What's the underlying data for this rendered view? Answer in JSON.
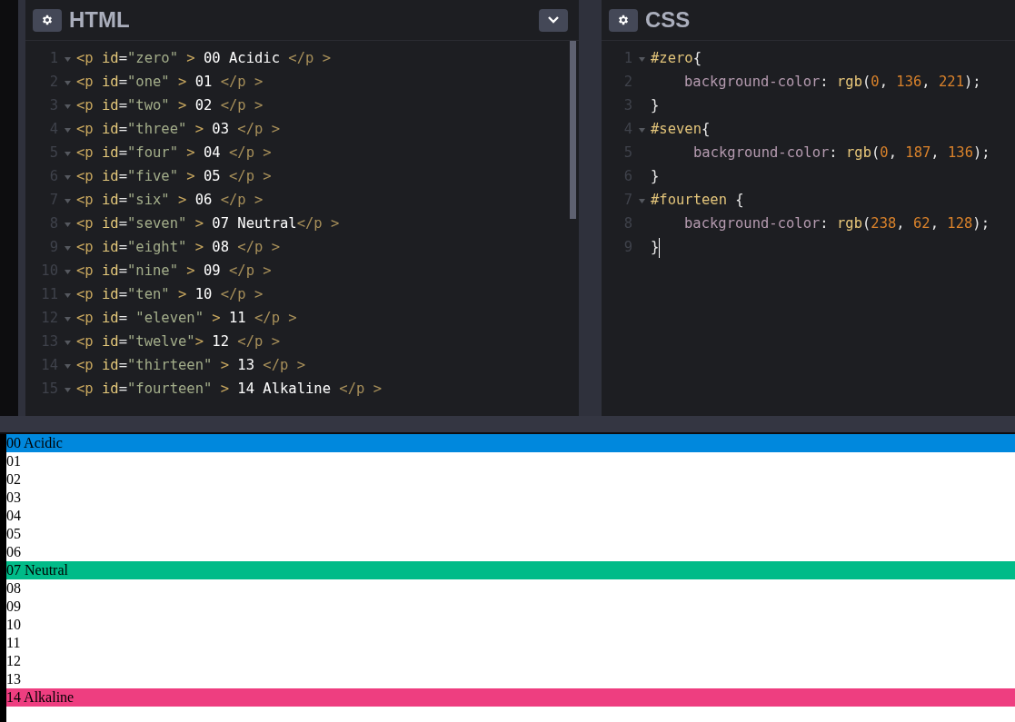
{
  "html_panel": {
    "title": "HTML",
    "lines": [
      {
        "number": "1",
        "foldable": true,
        "tokens": [
          {
            "kind": "tag",
            "text": "<p "
          },
          {
            "kind": "attr",
            "text": "id"
          },
          {
            "kind": "punct",
            "text": "="
          },
          {
            "kind": "string",
            "text": "\"zero\""
          },
          {
            "kind": "tag",
            "text": " > "
          },
          {
            "kind": "text",
            "text": "00 Acidic "
          },
          {
            "kind": "close",
            "text": "</p >"
          }
        ]
      },
      {
        "number": "2",
        "foldable": true,
        "tokens": [
          {
            "kind": "tag",
            "text": "<p "
          },
          {
            "kind": "attr",
            "text": "id"
          },
          {
            "kind": "punct",
            "text": "="
          },
          {
            "kind": "string",
            "text": "\"one\""
          },
          {
            "kind": "tag",
            "text": " > "
          },
          {
            "kind": "text",
            "text": "01 "
          },
          {
            "kind": "close",
            "text": "</p >"
          }
        ]
      },
      {
        "number": "3",
        "foldable": true,
        "tokens": [
          {
            "kind": "tag",
            "text": "<p "
          },
          {
            "kind": "attr",
            "text": "id"
          },
          {
            "kind": "punct",
            "text": "="
          },
          {
            "kind": "string",
            "text": "\"two\""
          },
          {
            "kind": "tag",
            "text": " > "
          },
          {
            "kind": "text",
            "text": "02 "
          },
          {
            "kind": "close",
            "text": "</p >"
          }
        ]
      },
      {
        "number": "4",
        "foldable": true,
        "tokens": [
          {
            "kind": "tag",
            "text": "<p "
          },
          {
            "kind": "attr",
            "text": "id"
          },
          {
            "kind": "punct",
            "text": "="
          },
          {
            "kind": "string",
            "text": "\"three\""
          },
          {
            "kind": "tag",
            "text": " > "
          },
          {
            "kind": "text",
            "text": "03 "
          },
          {
            "kind": "close",
            "text": "</p >"
          }
        ]
      },
      {
        "number": "5",
        "foldable": true,
        "tokens": [
          {
            "kind": "tag",
            "text": "<p "
          },
          {
            "kind": "attr",
            "text": "id"
          },
          {
            "kind": "punct",
            "text": "="
          },
          {
            "kind": "string",
            "text": "\"four\""
          },
          {
            "kind": "tag",
            "text": " > "
          },
          {
            "kind": "text",
            "text": "04 "
          },
          {
            "kind": "close",
            "text": "</p >"
          }
        ]
      },
      {
        "number": "6",
        "foldable": true,
        "tokens": [
          {
            "kind": "tag",
            "text": "<p "
          },
          {
            "kind": "attr",
            "text": "id"
          },
          {
            "kind": "punct",
            "text": "="
          },
          {
            "kind": "string",
            "text": "\"five\""
          },
          {
            "kind": "tag",
            "text": " > "
          },
          {
            "kind": "text",
            "text": "05 "
          },
          {
            "kind": "close",
            "text": "</p >"
          }
        ]
      },
      {
        "number": "7",
        "foldable": true,
        "tokens": [
          {
            "kind": "tag",
            "text": "<p "
          },
          {
            "kind": "attr",
            "text": "id"
          },
          {
            "kind": "punct",
            "text": "="
          },
          {
            "kind": "string",
            "text": "\"six\""
          },
          {
            "kind": "tag",
            "text": " > "
          },
          {
            "kind": "text",
            "text": "06 "
          },
          {
            "kind": "close",
            "text": "</p >"
          }
        ]
      },
      {
        "number": "8",
        "foldable": true,
        "tokens": [
          {
            "kind": "tag",
            "text": "<p "
          },
          {
            "kind": "attr",
            "text": "id"
          },
          {
            "kind": "punct",
            "text": "="
          },
          {
            "kind": "string",
            "text": "\"seven\""
          },
          {
            "kind": "tag",
            "text": " > "
          },
          {
            "kind": "text",
            "text": "07 Neutral"
          },
          {
            "kind": "close",
            "text": "</p >"
          }
        ]
      },
      {
        "number": "9",
        "foldable": true,
        "tokens": [
          {
            "kind": "tag",
            "text": "<p "
          },
          {
            "kind": "attr",
            "text": "id"
          },
          {
            "kind": "punct",
            "text": "="
          },
          {
            "kind": "string",
            "text": "\"eight\""
          },
          {
            "kind": "tag",
            "text": " > "
          },
          {
            "kind": "text",
            "text": "08 "
          },
          {
            "kind": "close",
            "text": "</p >"
          }
        ]
      },
      {
        "number": "10",
        "foldable": true,
        "tokens": [
          {
            "kind": "tag",
            "text": "<p "
          },
          {
            "kind": "attr",
            "text": "id"
          },
          {
            "kind": "punct",
            "text": "="
          },
          {
            "kind": "string",
            "text": "\"nine\""
          },
          {
            "kind": "tag",
            "text": " > "
          },
          {
            "kind": "text",
            "text": "09 "
          },
          {
            "kind": "close",
            "text": "</p >"
          }
        ]
      },
      {
        "number": "11",
        "foldable": true,
        "tokens": [
          {
            "kind": "tag",
            "text": "<p "
          },
          {
            "kind": "attr",
            "text": "id"
          },
          {
            "kind": "punct",
            "text": "="
          },
          {
            "kind": "string",
            "text": "\"ten\""
          },
          {
            "kind": "tag",
            "text": " > "
          },
          {
            "kind": "text",
            "text": "10 "
          },
          {
            "kind": "close",
            "text": "</p >"
          }
        ]
      },
      {
        "number": "12",
        "foldable": true,
        "tokens": [
          {
            "kind": "tag",
            "text": "<p "
          },
          {
            "kind": "attr",
            "text": "id"
          },
          {
            "kind": "punct",
            "text": "= "
          },
          {
            "kind": "string",
            "text": "\"eleven\""
          },
          {
            "kind": "tag",
            "text": " > "
          },
          {
            "kind": "text",
            "text": "11 "
          },
          {
            "kind": "close",
            "text": "</p >"
          }
        ]
      },
      {
        "number": "13",
        "foldable": true,
        "tokens": [
          {
            "kind": "tag",
            "text": "<p "
          },
          {
            "kind": "attr",
            "text": "id"
          },
          {
            "kind": "punct",
            "text": "="
          },
          {
            "kind": "string",
            "text": "\"twelve\""
          },
          {
            "kind": "tag",
            "text": "> "
          },
          {
            "kind": "text",
            "text": "12 "
          },
          {
            "kind": "close",
            "text": "</p >"
          }
        ]
      },
      {
        "number": "14",
        "foldable": true,
        "tokens": [
          {
            "kind": "tag",
            "text": "<p "
          },
          {
            "kind": "attr",
            "text": "id"
          },
          {
            "kind": "punct",
            "text": "="
          },
          {
            "kind": "string",
            "text": "\"thirteen\""
          },
          {
            "kind": "tag",
            "text": " > "
          },
          {
            "kind": "text",
            "text": "13 "
          },
          {
            "kind": "close",
            "text": "</p >"
          }
        ]
      },
      {
        "number": "15",
        "foldable": true,
        "tokens": [
          {
            "kind": "tag",
            "text": "<p "
          },
          {
            "kind": "attr",
            "text": "id"
          },
          {
            "kind": "punct",
            "text": "="
          },
          {
            "kind": "string",
            "text": "\"fourteen\""
          },
          {
            "kind": "tag",
            "text": " > "
          },
          {
            "kind": "text",
            "text": "14 Alkaline "
          },
          {
            "kind": "close",
            "text": "</p >"
          }
        ]
      }
    ]
  },
  "css_panel": {
    "title": "CSS",
    "lines": [
      {
        "number": "1",
        "foldable": true,
        "tokens": [
          {
            "kind": "selector",
            "text": "#zero"
          },
          {
            "kind": "punct",
            "text": "{"
          }
        ]
      },
      {
        "number": "2",
        "foldable": false,
        "kind": "declaration",
        "tokens": [
          {
            "kind": "property",
            "text": "background-color"
          },
          {
            "kind": "punct",
            "text": ": "
          },
          {
            "kind": "func",
            "text": "rgb"
          },
          {
            "kind": "punct",
            "text": "("
          },
          {
            "kind": "number",
            "text": "0"
          },
          {
            "kind": "punct",
            "text": ", "
          },
          {
            "kind": "number",
            "text": "136"
          },
          {
            "kind": "punct",
            "text": ", "
          },
          {
            "kind": "number",
            "text": "221"
          },
          {
            "kind": "punct",
            "text": ");"
          }
        ]
      },
      {
        "number": "3",
        "foldable": false,
        "tokens": [
          {
            "kind": "punct",
            "text": "}"
          }
        ]
      },
      {
        "number": "4",
        "foldable": true,
        "tokens": [
          {
            "kind": "selector",
            "text": "#seven"
          },
          {
            "kind": "punct",
            "text": "{"
          }
        ]
      },
      {
        "number": "5",
        "foldable": false,
        "kind": "declaration-offset",
        "tokens": [
          {
            "kind": "property",
            "text": "background-color"
          },
          {
            "kind": "punct",
            "text": ": "
          },
          {
            "kind": "func",
            "text": "rgb"
          },
          {
            "kind": "punct",
            "text": "("
          },
          {
            "kind": "number",
            "text": "0"
          },
          {
            "kind": "punct",
            "text": ", "
          },
          {
            "kind": "number",
            "text": "187"
          },
          {
            "kind": "punct",
            "text": ", "
          },
          {
            "kind": "number",
            "text": "136"
          },
          {
            "kind": "punct",
            "text": ");"
          }
        ]
      },
      {
        "number": "6",
        "foldable": false,
        "tokens": [
          {
            "kind": "punct",
            "text": "}"
          }
        ]
      },
      {
        "number": "7",
        "foldable": true,
        "tokens": [
          {
            "kind": "selector",
            "text": "#fourteen "
          },
          {
            "kind": "punct",
            "text": "{"
          }
        ]
      },
      {
        "number": "8",
        "foldable": false,
        "kind": "declaration",
        "tokens": [
          {
            "kind": "property",
            "text": "background-color"
          },
          {
            "kind": "punct",
            "text": ": "
          },
          {
            "kind": "func",
            "text": "rgb"
          },
          {
            "kind": "punct",
            "text": "("
          },
          {
            "kind": "number",
            "text": "238"
          },
          {
            "kind": "punct",
            "text": ", "
          },
          {
            "kind": "number",
            "text": "62"
          },
          {
            "kind": "punct",
            "text": ", "
          },
          {
            "kind": "number",
            "text": "128"
          },
          {
            "kind": "punct",
            "text": ");"
          }
        ]
      },
      {
        "number": "9",
        "foldable": false,
        "cursor": true,
        "tokens": [
          {
            "kind": "punct",
            "text": "}"
          }
        ]
      }
    ]
  },
  "preview": {
    "rows": [
      {
        "text": "00 Acidic",
        "color": "#0088dd"
      },
      {
        "text": "01"
      },
      {
        "text": "02"
      },
      {
        "text": "03"
      },
      {
        "text": "04"
      },
      {
        "text": "05"
      },
      {
        "text": "06"
      },
      {
        "text": "07 Neutral",
        "color": "#00bb88"
      },
      {
        "text": "08"
      },
      {
        "text": "09"
      },
      {
        "text": "10"
      },
      {
        "text": "11"
      },
      {
        "text": "12"
      },
      {
        "text": "13"
      },
      {
        "text": "14 Alkaline",
        "color": "#ee3e80"
      }
    ]
  }
}
